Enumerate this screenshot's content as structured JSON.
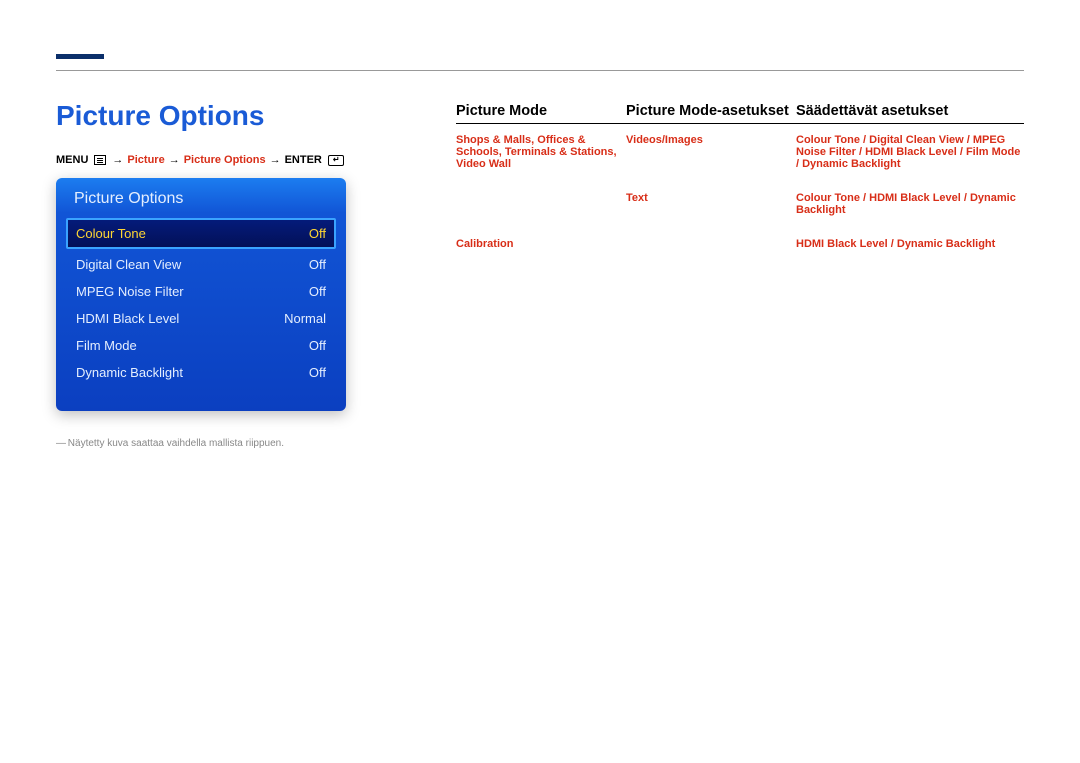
{
  "page_title": "Picture Options",
  "breadcrumb": {
    "menu": "MENU",
    "arrow": "→",
    "seg1": "Picture",
    "seg2": "Picture Options",
    "enter": "ENTER"
  },
  "osd": {
    "title": "Picture Options",
    "rows": [
      {
        "label": "Colour Tone",
        "value": "Off",
        "selected": true
      },
      {
        "label": "Digital Clean View",
        "value": "Off",
        "selected": false
      },
      {
        "label": "MPEG Noise Filter",
        "value": "Off",
        "selected": false
      },
      {
        "label": "HDMI Black Level",
        "value": "Normal",
        "selected": false
      },
      {
        "label": "Film Mode",
        "value": "Off",
        "selected": false
      },
      {
        "label": "Dynamic Backlight",
        "value": "Off",
        "selected": false
      }
    ]
  },
  "footnote_prefix": "―",
  "footnote": "Näytetty kuva saattaa vaihdella mallista riippuen.",
  "table": {
    "headers": [
      "Picture Mode",
      "Picture Mode-asetukset",
      "Säädettävät asetukset"
    ],
    "rows": [
      {
        "c1": "Shops & Malls, Offices & Schools, Terminals & Stations, Video Wall",
        "c2": "Videos/Images",
        "c3": "Colour Tone / Digital Clean View / MPEG Noise Filter / HDMI Black Level / Film Mode / Dynamic Backlight"
      },
      {
        "c1": "",
        "c2": "Text",
        "c3": "Colour Tone / HDMI Black Level / Dynamic Backlight"
      },
      {
        "c1": "Calibration",
        "c2": "",
        "c3": "HDMI Black Level / Dynamic Backlight"
      }
    ]
  }
}
